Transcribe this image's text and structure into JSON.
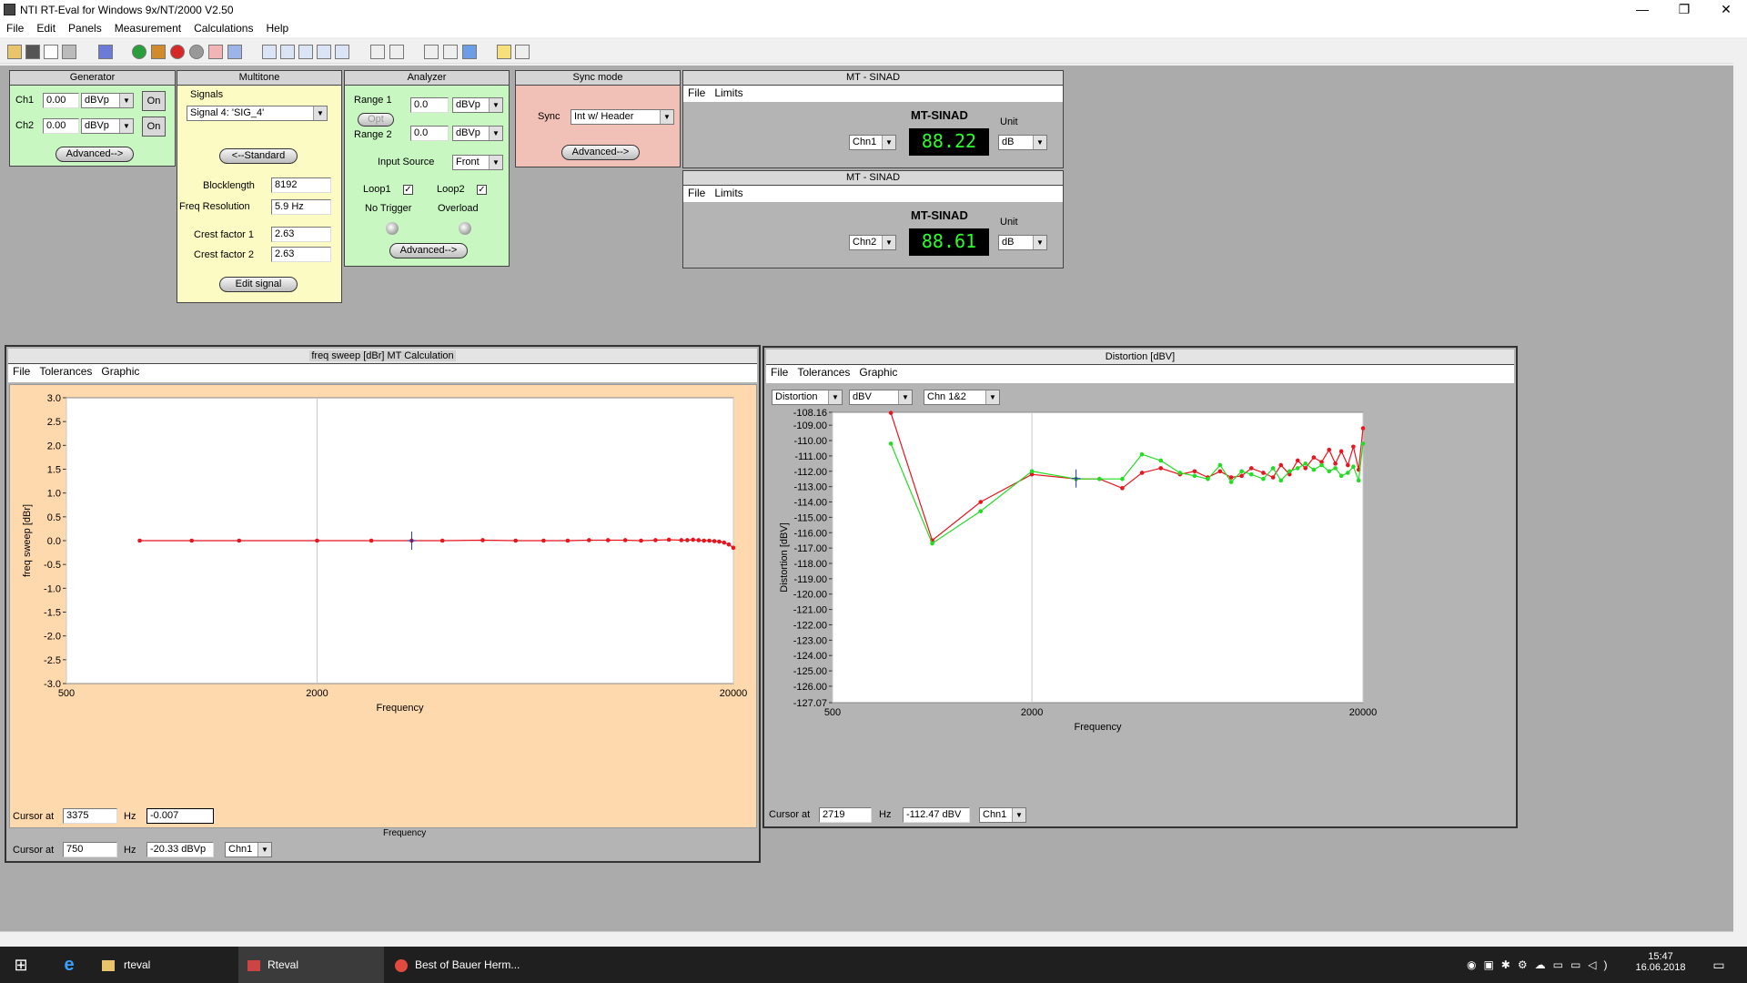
{
  "window": {
    "title": "NTI RT-Eval for Windows 9x/NT/2000  V2.50",
    "min": "—",
    "max": "❐",
    "close": "✕"
  },
  "menu": [
    "File",
    "Edit",
    "Panels",
    "Measurement",
    "Calculations",
    "Help"
  ],
  "generator": {
    "title": "Generator",
    "ch1_label": "Ch1",
    "ch1_value": "0.00",
    "ch1_unit": "dBVp",
    "ch1_on": "On",
    "ch2_label": "Ch2",
    "ch2_value": "0.00",
    "ch2_unit": "dBVp",
    "ch2_on": "On",
    "advanced": "Advanced-->"
  },
  "multitone": {
    "title": "Multitone",
    "signals_label": "Signals",
    "signal": "Signal 4:  'SIG_4'",
    "standard": "<--Standard",
    "blocklength_label": "Blocklength",
    "blocklength": "8192",
    "freqres_label": "Freq Resolution",
    "freqres": "5.9 Hz",
    "crest1_label": "Crest factor 1",
    "crest1": "2.63",
    "crest2_label": "Crest factor 2",
    "crest2": "2.63",
    "edit": "Edit signal"
  },
  "analyzer": {
    "title": "Analyzer",
    "range1_label": "Range 1",
    "range1": "0.0",
    "range1_unit": "dBVp",
    "opt": "Opt",
    "range2_label": "Range 2",
    "range2": "0.0",
    "range2_unit": "dBVp",
    "input_label": "Input Source",
    "input": "Front",
    "loop1": "Loop1",
    "loop2": "Loop2",
    "notrigger": "No Trigger",
    "overload": "Overload",
    "advanced": "Advanced-->"
  },
  "sync": {
    "title": "Sync mode",
    "sync_label": "Sync",
    "sync": "Int w/ Header",
    "advanced": "Advanced-->"
  },
  "sinad": [
    {
      "title": "MT - SINAD",
      "menu": [
        "File",
        "Limits"
      ],
      "heading": "MT-SINAD",
      "unit_label": "Unit",
      "channel": "Chn1",
      "value": "88.22",
      "unit": "dB"
    },
    {
      "title": "MT - SINAD",
      "menu": [
        "File",
        "Limits"
      ],
      "heading": "MT-SINAD",
      "unit_label": "Unit",
      "channel": "Chn2",
      "value": "88.61",
      "unit": "dB"
    }
  ],
  "freqwin": {
    "title": "freq sweep [dBr] MT Calculation",
    "menu": [
      "File",
      "Tolerances",
      "Graphic"
    ],
    "cursor_label": "Cursor at",
    "cursor_freq": "3375",
    "hz": "Hz",
    "cursor_value": "-0.007",
    "under_label": "Frequency",
    "bottom_cursor_label": "Cursor at",
    "bottom_cursor_freq": "750",
    "bottom_hz": "Hz",
    "bottom_cursor_value": "-20.33 dBVp",
    "bottom_channel": "Chn1"
  },
  "distwin": {
    "title": "Distortion [dBV]",
    "menu": [
      "File",
      "Tolerances",
      "Graphic"
    ],
    "sel_type": "Distortion",
    "sel_unit": "dBV",
    "sel_channel": "Chn 1&2",
    "cursor_label": "Cursor at",
    "cursor_freq": "2719",
    "hz": "Hz",
    "cursor_value": "-112.47 dBV",
    "channel": "Chn1"
  },
  "chart_data": [
    {
      "type": "line",
      "title": "",
      "xlabel": "Frequency",
      "ylabel": "freq sweep [dBr]",
      "xscale": "log",
      "xlim": [
        500,
        20000
      ],
      "ylim": [
        -3.0,
        3.0
      ],
      "xticks": [
        "500",
        "2000",
        "20000"
      ],
      "yticks": [
        "3.0",
        "2.5",
        "2.0",
        "1.5",
        "1.0",
        "0.5",
        "0.0",
        "-0.5",
        "-1.0",
        "-1.5",
        "-2.0",
        "-2.5",
        "-3.0"
      ],
      "grid": true,
      "series": [
        {
          "color": "#e8141e",
          "x": [
            750,
            1000,
            1300,
            2000,
            2700,
            3375,
            4000,
            5000,
            6000,
            7000,
            8000,
            9000,
            10000,
            11000,
            12000,
            13000,
            14000,
            15000,
            15500,
            16000,
            16500,
            17000,
            17500,
            18000,
            18500,
            19000,
            19500,
            20000
          ],
          "y": [
            0,
            0,
            0,
            0,
            0,
            0,
            0,
            0.01,
            0,
            0,
            0,
            0.01,
            0.01,
            0.01,
            0,
            0.01,
            0.02,
            0.01,
            0.01,
            0.02,
            0.01,
            0,
            0,
            -0.01,
            -0.02,
            -0.04,
            -0.08,
            -0.15
          ]
        }
      ]
    },
    {
      "type": "line",
      "title": "",
      "xlabel": "Frequency",
      "ylabel": "Distortion [dBV]",
      "xscale": "log",
      "xlim": [
        500,
        20000
      ],
      "ylim": [
        -127.07,
        -108.16
      ],
      "xticks": [
        "500",
        "2000",
        "20000"
      ],
      "yticks": [
        "-108.16",
        "-109.00",
        "-110.00",
        "-111.00",
        "-112.00",
        "-113.00",
        "-114.00",
        "-115.00",
        "-116.00",
        "-117.00",
        "-118.00",
        "-119.00",
        "-120.00",
        "-121.00",
        "-122.00",
        "-123.00",
        "-124.00",
        "-125.00",
        "-126.00",
        "-127.07"
      ],
      "grid": true,
      "series": [
        {
          "color": "#e8141e",
          "x": [
            750,
            1000,
            1400,
            2000,
            2719,
            3200,
            3750,
            4300,
            4900,
            5600,
            6200,
            6800,
            7400,
            8000,
            8600,
            9200,
            10000,
            10700,
            11300,
            12000,
            12700,
            13400,
            14200,
            15000,
            15800,
            16500,
            17200,
            18000,
            18700,
            19400,
            20000
          ],
          "y": [
            -108.2,
            -116.5,
            -114.0,
            -112.2,
            -112.5,
            -112.5,
            -113.1,
            -112.1,
            -111.8,
            -112.2,
            -112.0,
            -112.4,
            -112.0,
            -112.4,
            -112.3,
            -111.8,
            -112.1,
            -112.4,
            -111.6,
            -112.2,
            -111.3,
            -111.8,
            -111.1,
            -111.4,
            -110.6,
            -111.5,
            -110.7,
            -111.6,
            -110.4,
            -111.9,
            -109.2
          ]
        },
        {
          "color": "#22dd22",
          "x": [
            750,
            1000,
            1400,
            2000,
            2719,
            3200,
            3750,
            4300,
            4900,
            5600,
            6200,
            6800,
            7400,
            8000,
            8600,
            9200,
            10000,
            10700,
            11300,
            12000,
            12700,
            13400,
            14200,
            15000,
            15800,
            16500,
            17200,
            18000,
            18700,
            19400,
            20000
          ],
          "y": [
            -110.2,
            -116.7,
            -114.6,
            -112.0,
            -112.5,
            -112.5,
            -112.5,
            -110.9,
            -111.3,
            -112.1,
            -112.3,
            -112.5,
            -111.6,
            -112.7,
            -112.0,
            -112.2,
            -112.5,
            -111.8,
            -112.6,
            -112.0,
            -111.8,
            -111.5,
            -111.9,
            -111.6,
            -112.0,
            -111.8,
            -112.3,
            -112.1,
            -111.7,
            -112.6,
            -110.2
          ]
        }
      ]
    }
  ],
  "taskbar": {
    "items": [
      "rteval",
      "Rteval",
      "Best of Bauer Herm..."
    ],
    "time": "15:47",
    "date": "16.06.2018"
  }
}
